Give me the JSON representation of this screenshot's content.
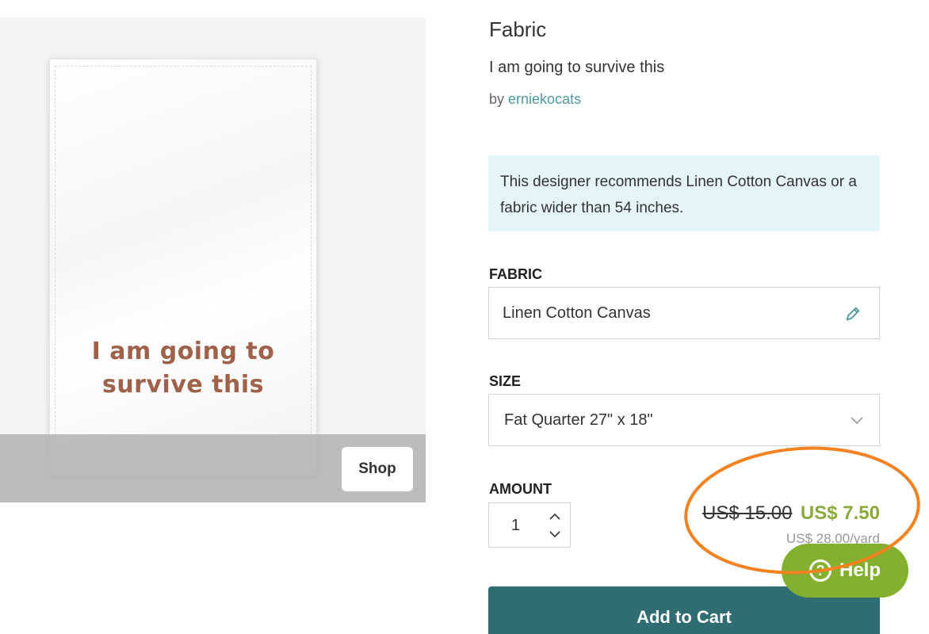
{
  "image": {
    "print_text": "I am going to survive this",
    "shop_label": "Shop"
  },
  "product": {
    "category": "Fabric",
    "title": "I am going to survive this",
    "by_prefix": "by",
    "designer": "erniekocats",
    "recommendation": "This designer recommends Linen Cotton Canvas or a fabric wider than 54 inches."
  },
  "fabric": {
    "label": "FABRIC",
    "value": "Linen Cotton Canvas",
    "icon": "pencil-icon"
  },
  "size": {
    "label": "SIZE",
    "value": "Fat Quarter 27\" x 18\"",
    "icon": "chevron-down-icon"
  },
  "amount": {
    "label": "AMOUNT",
    "value": "1"
  },
  "price": {
    "old": "US$ 15.00",
    "new": "US$ 7.50",
    "per_yard": "US$ 28.00/yard",
    "sale_color": "#8aab3b"
  },
  "cart": {
    "label": "Add to Cart",
    "color": "#2f6d72"
  },
  "help": {
    "label": "Help",
    "color": "#84b030"
  },
  "annotation": {
    "color": "#f58220",
    "shape": "ellipse"
  }
}
